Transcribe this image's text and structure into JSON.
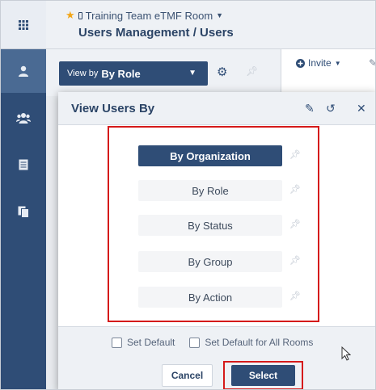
{
  "app": {
    "room_name": "Training Team eTMF Room",
    "page_title": "Users Management / Users"
  },
  "toolbar": {
    "viewby_prefix": "View by",
    "viewby_value": "By Role",
    "invite_label": "Invite"
  },
  "modal": {
    "title": "View Users By",
    "options": [
      {
        "label": "By Organization",
        "selected": true
      },
      {
        "label": "By Role",
        "selected": false
      },
      {
        "label": "By Status",
        "selected": false
      },
      {
        "label": "By Group",
        "selected": false
      },
      {
        "label": "By Action",
        "selected": false
      }
    ],
    "set_default_label": "Set Default",
    "set_default_all_label": "Set Default for All Rooms",
    "cancel_label": "Cancel",
    "select_label": "Select"
  },
  "colors": {
    "primary": "#2f4d76",
    "highlight": "#d51a1a",
    "star": "#f2a516"
  },
  "icons": {
    "rail": [
      "grid-icon",
      "user-icon",
      "users-icon",
      "document-icon",
      "documents-icon"
    ],
    "modal": [
      "pencil-icon",
      "reset-icon",
      "close-icon"
    ]
  }
}
